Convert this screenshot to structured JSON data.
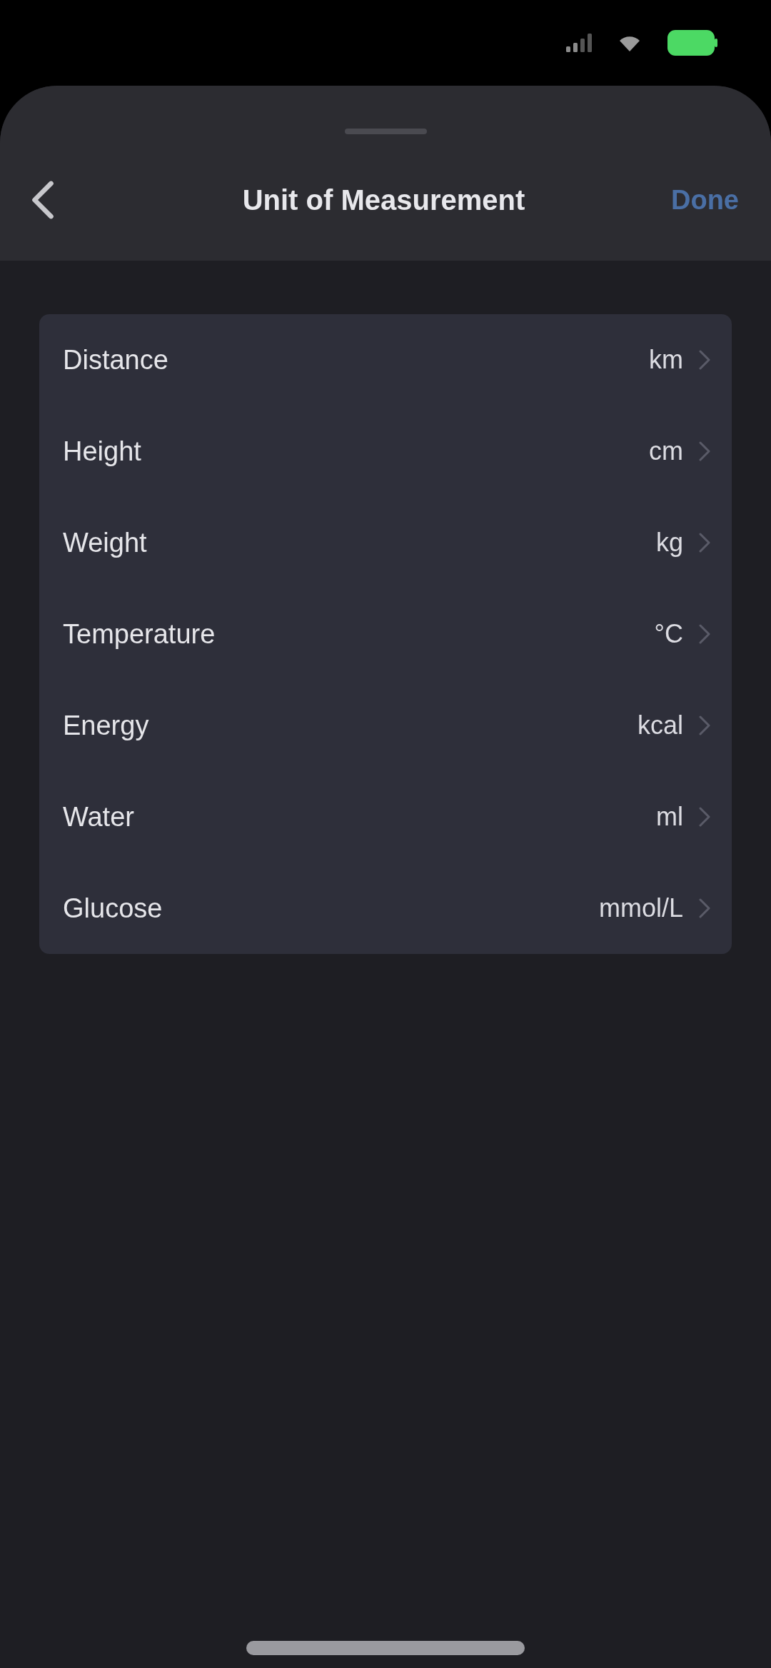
{
  "header": {
    "title": "Unit of Measurement",
    "action": "Done"
  },
  "settings": [
    {
      "label": "Distance",
      "value": "km"
    },
    {
      "label": "Height",
      "value": "cm"
    },
    {
      "label": "Weight",
      "value": "kg"
    },
    {
      "label": "Temperature",
      "value": "°C"
    },
    {
      "label": "Energy",
      "value": "kcal"
    },
    {
      "label": "Water",
      "value": "ml"
    },
    {
      "label": "Glucose",
      "value": "mmol/L"
    }
  ]
}
